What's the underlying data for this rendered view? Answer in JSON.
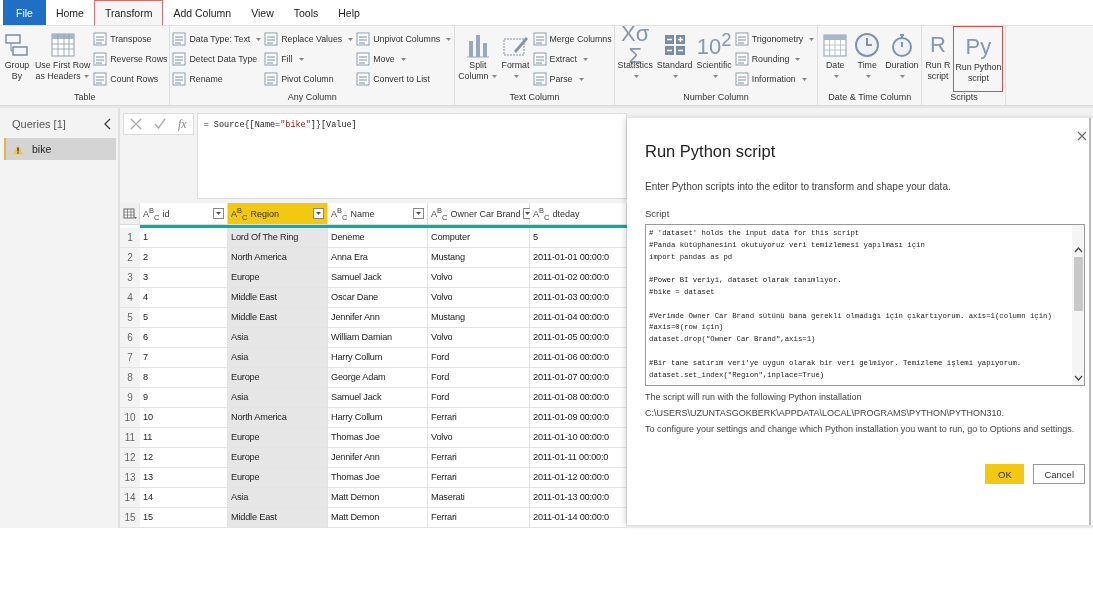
{
  "tabs": [
    {
      "label": "File",
      "kind": "file",
      "selected": false
    },
    {
      "label": "Home",
      "kind": "tab",
      "selected": false
    },
    {
      "label": "Transform",
      "kind": "tab",
      "selected": true
    },
    {
      "label": "Add Column",
      "kind": "tab",
      "selected": false
    },
    {
      "label": "View",
      "kind": "tab",
      "selected": false
    },
    {
      "label": "Tools",
      "kind": "tab",
      "selected": false
    },
    {
      "label": "Help",
      "kind": "tab",
      "selected": false
    }
  ],
  "ribbon": {
    "groups": [
      {
        "label": "Table",
        "columns": [
          {
            "kind": "large",
            "label": "Group\nBy",
            "dropdown": false,
            "highlighted": false
          },
          {
            "kind": "large",
            "label": "Use First Row\nas Headers",
            "dropdown": true,
            "highlighted": false
          },
          {
            "kind": "stack",
            "items": [
              {
                "label": "Transpose",
                "dropdown": false
              },
              {
                "label": "Reverse Rows",
                "dropdown": false
              },
              {
                "label": "Count Rows",
                "dropdown": false
              }
            ]
          }
        ]
      },
      {
        "label": "Any Column",
        "columns": [
          {
            "kind": "stack",
            "items": [
              {
                "label": "Data Type: Text",
                "dropdown": true
              },
              {
                "label": "Detect Data Type",
                "dropdown": false
              },
              {
                "label": "Rename",
                "dropdown": false
              }
            ]
          },
          {
            "kind": "stack",
            "items": [
              {
                "label": "Replace Values",
                "dropdown": true
              },
              {
                "label": "Fill",
                "dropdown": true
              },
              {
                "label": "Pivot Column",
                "dropdown": false
              }
            ]
          },
          {
            "kind": "stack",
            "items": [
              {
                "label": "Unpivot Columns",
                "dropdown": true
              },
              {
                "label": "Move",
                "dropdown": true
              },
              {
                "label": "Convert to List",
                "dropdown": false
              }
            ]
          }
        ]
      },
      {
        "label": "Text Column",
        "columns": [
          {
            "kind": "large",
            "label": "Split\nColumn",
            "dropdown": true,
            "highlighted": false
          },
          {
            "kind": "large",
            "label": "Format",
            "dropdown": true,
            "highlighted": false
          },
          {
            "kind": "stack",
            "items": [
              {
                "label": "Merge Columns",
                "dropdown": false
              },
              {
                "label": "Extract",
                "dropdown": true
              },
              {
                "label": "Parse",
                "dropdown": true
              }
            ]
          }
        ]
      },
      {
        "label": "Number Column",
        "columns": [
          {
            "kind": "large",
            "label": "Statistics",
            "glyph": "Xσ\nΣ",
            "dropdown": true,
            "highlighted": false
          },
          {
            "kind": "large",
            "label": "Standard",
            "dropdown": true,
            "highlighted": false
          },
          {
            "kind": "large",
            "label": "Scientific",
            "glyph": "10$^{2}$",
            "dropdown": true,
            "highlighted": false
          },
          {
            "kind": "stack",
            "items": [
              {
                "label": "Trigonometry",
                "dropdown": true
              },
              {
                "label": "Rounding",
                "dropdown": true
              },
              {
                "label": "Information",
                "dropdown": true
              }
            ]
          }
        ]
      },
      {
        "label": "Date & Time Column",
        "columns": [
          {
            "kind": "large",
            "label": "Date",
            "dropdown": true,
            "highlighted": false
          },
          {
            "kind": "large",
            "label": "Time",
            "dropdown": true,
            "highlighted": false
          },
          {
            "kind": "large",
            "label": "Duration",
            "dropdown": true,
            "highlighted": false
          }
        ]
      },
      {
        "label": "Scripts",
        "columns": [
          {
            "kind": "large",
            "label": "Run R\nscript",
            "glyph": "R",
            "dropdown": false,
            "highlighted": false
          },
          {
            "kind": "large",
            "label": "Run Python\nscript",
            "glyph": "Py",
            "dropdown": false,
            "highlighted": true
          }
        ]
      }
    ]
  },
  "sidebar": {
    "title": "Queries [1]",
    "items": [
      {
        "name": "bike",
        "selected": true,
        "warning": true
      }
    ]
  },
  "formula_bar": {
    "fx": "fx",
    "formula": [
      {
        "kind": "plain",
        "text": "= Source{[Name="
      },
      {
        "kind": "string",
        "text": "\"bike\""
      },
      {
        "kind": "plain",
        "text": "]}[Value]"
      }
    ]
  },
  "table": {
    "columns": [
      {
        "name": "id",
        "type": "A$^{B}$$_{C}$",
        "selected": false,
        "filter": true
      },
      {
        "name": "Region",
        "type": "A$^{B}$$_{C}$",
        "selected": true,
        "filter": true
      },
      {
        "name": "Name",
        "type": "A$^{B}$$_{C}$",
        "selected": false,
        "filter": true
      },
      {
        "name": "Owner Car Brand",
        "type": "A$^{B}$$_{C}$",
        "selected": false,
        "filter": true
      },
      {
        "name": "dteday",
        "type": "A$^{B}$$_{C}$",
        "selected": false,
        "filter": false
      }
    ],
    "rows": [
      {
        "number": "1",
        "cells": [
          "1",
          "Lord Of The Ring",
          "Deneme",
          "Computer",
          "5"
        ]
      },
      {
        "number": "2",
        "cells": [
          "2",
          "North America",
          "Anna Era",
          "Mustang",
          "2011-01-01 00:00:0"
        ]
      },
      {
        "number": "3",
        "cells": [
          "3",
          "Europe",
          "Samuel Jack",
          "Volvo",
          "2011-01-02 00:00:0"
        ]
      },
      {
        "number": "4",
        "cells": [
          "4",
          "Middle East",
          "Oscar Dane",
          "Volvo",
          "2011-01-03 00:00:0"
        ]
      },
      {
        "number": "5",
        "cells": [
          "5",
          "Middle East",
          "Jennifer Ann",
          "Mustang",
          "2011-01-04 00:00:0"
        ]
      },
      {
        "number": "6",
        "cells": [
          "6",
          "Asia",
          "William Damian",
          "Volvo",
          "2011-01-05 00:00:0"
        ]
      },
      {
        "number": "7",
        "cells": [
          "7",
          "Asia",
          "Harry Collum",
          "Ford",
          "2011-01-06 00:00:0"
        ]
      },
      {
        "number": "8",
        "cells": [
          "8",
          "Europe",
          "George Adam",
          "Ford",
          "2011-01-07 00:00:0"
        ]
      },
      {
        "number": "9",
        "cells": [
          "9",
          "Asia",
          "Samuel Jack",
          "Ford",
          "2011-01-08 00:00:0"
        ]
      },
      {
        "number": "10",
        "cells": [
          "10",
          "North America",
          "Harry Collum",
          "Ferrari",
          "2011-01-09 00:00:0"
        ]
      },
      {
        "number": "11",
        "cells": [
          "11",
          "Europe",
          "Thomas Joe",
          "Volvo",
          "2011-01-10 00:00:0"
        ]
      },
      {
        "number": "12",
        "cells": [
          "12",
          "Europe",
          "Jennifer Ann",
          "Ferrari",
          "2011-01-11 00:00:0"
        ]
      },
      {
        "number": "13",
        "cells": [
          "13",
          "Europe",
          "Thomas Joe",
          "Ferrari",
          "2011-01-12 00:00:0"
        ]
      },
      {
        "number": "14",
        "cells": [
          "14",
          "Asia",
          "Matt Demon",
          "Maserati",
          "2011-01-13 00:00:0"
        ]
      },
      {
        "number": "15",
        "cells": [
          "15",
          "Middle East",
          "Matt Demon",
          "Ferrari",
          "2011-01-14 00:00:0"
        ]
      }
    ]
  },
  "dialog": {
    "title": "Run Python script",
    "description": "Enter Python scripts into the editor to transform and shape your data.",
    "script_label": "Script",
    "script": "# 'dataset' holds the input data for this script\n#Panda kütüphanesini okutuyoruz veri temizlemesi yapılması için\nimport pandas as pd\n\n#Power BI veriyi, dataset olarak tanımlıyor.\n#bike = dataset\n\n#Verimde Owner Car Brand sütünü bana gerekli olmadığı için çıkartıyorum. axis=1(column için)\n#axis=0(row için)\ndataset.drop(\"Owner Car Brand\",axis=1)\n\n#Bir tane satırım veri'ye uygun olarak bir veri gelmiyor. Temizleme işlemi yapıyorum.\ndataset.set_index(\"Regıon\",inplace=True)",
    "notes": [
      "The script will run with the following Python installation",
      "C:\\USERS\\UZUNTASGOKBERK\\APPDATA\\LOCAL\\PROGRAMS\\PYTHON\\PYTHON310.",
      "To configure your settings and change which Python installation you want to run, go to Options and settings."
    ],
    "buttons": [
      {
        "label": "OK",
        "kind": "primary"
      },
      {
        "label": "Cancel",
        "kind": "secondary"
      }
    ]
  }
}
